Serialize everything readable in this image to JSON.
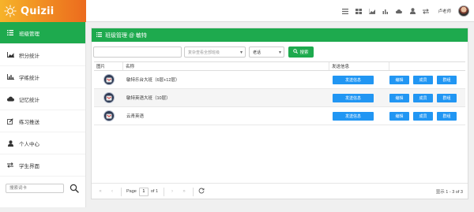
{
  "app": {
    "name": "Quizii"
  },
  "header": {
    "icons": [
      "list-icon",
      "grid-icon",
      "chart-icon",
      "chart-alt-icon",
      "cloud-icon",
      "user-icon",
      "swap-icon"
    ],
    "user_name": "卢老师"
  },
  "sidebar": {
    "items": [
      {
        "label": "班级管理",
        "icon": "list-icon",
        "active": true
      },
      {
        "label": "积分统计",
        "icon": "area-chart-icon",
        "active": false
      },
      {
        "label": "学练统计",
        "icon": "bar-chart-icon",
        "active": false
      },
      {
        "label": "记忆统计",
        "icon": "cloud-icon",
        "active": false
      },
      {
        "label": "练习推送",
        "icon": "edit-icon",
        "active": false
      },
      {
        "label": "个人中心",
        "icon": "user-icon",
        "active": false
      },
      {
        "label": "学生界面",
        "icon": "swap-icon",
        "active": false
      }
    ],
    "search_placeholder": "搜索词卡"
  },
  "panel": {
    "title": "班级管理 @ 敏特",
    "filters": {
      "keyword_value": "",
      "type_placeholder": "复杂查看全部班级",
      "status_value": "老话",
      "search_label": "搜索"
    },
    "columns": [
      "图片",
      "名称",
      "发送信息",
      ""
    ],
    "rows": [
      {
        "name": "敏特乐台大班（6层+12层）",
        "send": "发送信息",
        "edit": "编辑",
        "members": "成员",
        "group": "群组"
      },
      {
        "name": "敏特英语大班（10层）",
        "send": "发送信息",
        "edit": "编辑",
        "members": "成员",
        "group": "群组"
      },
      {
        "name": "云青英语",
        "send": "发送信息",
        "edit": "编辑",
        "members": "成员",
        "group": "群组"
      }
    ]
  },
  "pager": {
    "page_label": "Page",
    "page_value": "1",
    "of_label": "of 1",
    "info": "显示 1 - 3 of 3"
  },
  "colors": {
    "green": "#1eaa4e",
    "blue": "#2196f3",
    "brand": "#f08a22"
  }
}
